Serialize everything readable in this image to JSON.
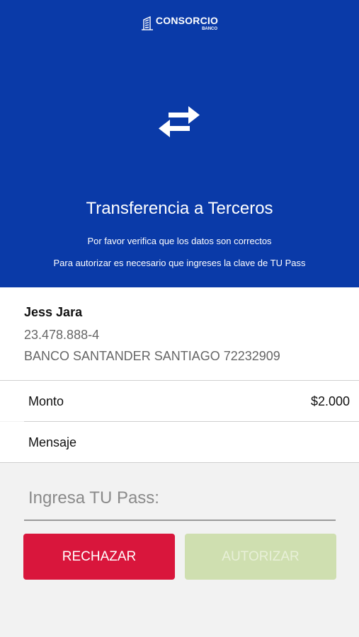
{
  "brand": {
    "name": "CONSORCIO",
    "sub": "BANCO",
    "color": "#0a3aa8"
  },
  "header": {
    "icon": "transfer-arrows-icon",
    "title": "Transferencia a Terceros",
    "line1": "Por favor verifica que los datos son correctos",
    "line2": "Para autorizar es necesario que ingreses la clave de TU Pass"
  },
  "recipient": {
    "name": "Jess Jara",
    "rut": "23.478.888-4",
    "bank": "BANCO SANTANDER SANTIAGO 72232909"
  },
  "details": {
    "amount_label": "Monto",
    "amount_value": "$2.000",
    "message_label": "Mensaje"
  },
  "pass": {
    "value": "",
    "placeholder": "Ingresa TU Pass:"
  },
  "buttons": {
    "reject": "RECHAZAR",
    "authorize": "AUTORIZAR",
    "reject_color": "#d9163c",
    "authorize_color": "#cfdfb0"
  }
}
